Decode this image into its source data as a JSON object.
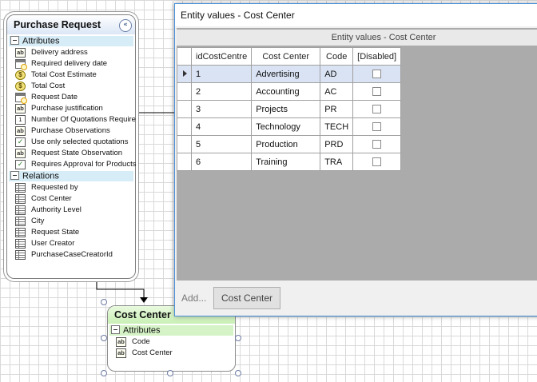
{
  "purchase_request": {
    "title": "Purchase Request",
    "collapse_glyph": "«",
    "attributes_label": "Attributes",
    "attributes": [
      {
        "label": "Delivery address",
        "icon": "text-icon"
      },
      {
        "label": "Required delivery date",
        "icon": "date-icon"
      },
      {
        "label": "Total Cost Estimate",
        "icon": "currency-icon"
      },
      {
        "label": "Total Cost",
        "icon": "currency-icon"
      },
      {
        "label": "Request Date",
        "icon": "date-icon"
      },
      {
        "label": "Purchase justification",
        "icon": "text-icon"
      },
      {
        "label": "Number Of Quotations Require",
        "icon": "number-icon"
      },
      {
        "label": "Purchase Observations",
        "icon": "text-icon"
      },
      {
        "label": "Use only selected quotations",
        "icon": "boolean-icon"
      },
      {
        "label": "Request State Observation",
        "icon": "text-icon"
      },
      {
        "label": "Requires Approval for Products",
        "icon": "boolean-icon"
      }
    ],
    "relations_label": "Relations",
    "relations": [
      {
        "label": "Requested by"
      },
      {
        "label": "Cost Center"
      },
      {
        "label": "Authority Level"
      },
      {
        "label": "City"
      },
      {
        "label": "Request State"
      },
      {
        "label": "User Creator"
      },
      {
        "label": "PurchaseCaseCreatorId"
      }
    ]
  },
  "cost_center_entity": {
    "title": "Cost Center",
    "attributes_label": "Attributes",
    "attributes": [
      {
        "label": "Code",
        "icon": "text-icon"
      },
      {
        "label": "Cost Center",
        "icon": "text-icon"
      }
    ]
  },
  "dialog": {
    "title": "Entity values - Cost Center",
    "grid_caption": "Entity values - Cost Center",
    "columns": [
      "idCostCentre",
      "Cost Center",
      "Code",
      "[Disabled]"
    ],
    "rows": [
      {
        "id": "1",
        "name": "Advertising",
        "code": "AD",
        "disabled": false
      },
      {
        "id": "2",
        "name": "Accounting",
        "code": "AC",
        "disabled": false
      },
      {
        "id": "3",
        "name": "Projects",
        "code": "PR",
        "disabled": false
      },
      {
        "id": "4",
        "name": "Technology",
        "code": "TECH",
        "disabled": false
      },
      {
        "id": "5",
        "name": "Production",
        "code": "PRD",
        "disabled": false
      },
      {
        "id": "6",
        "name": "Training",
        "code": "TRA",
        "disabled": false
      }
    ],
    "add_label": "Add...",
    "button_label": "Cost Center"
  },
  "colors": {
    "entity_header_blue": "#dbe6f6",
    "entity_header_green": "#c9f0b5",
    "section_blue": "#d6ecf7",
    "section_green": "#d6f3c7",
    "selected_row": "#d9e3f3",
    "dialog_border": "#4a90d9"
  }
}
